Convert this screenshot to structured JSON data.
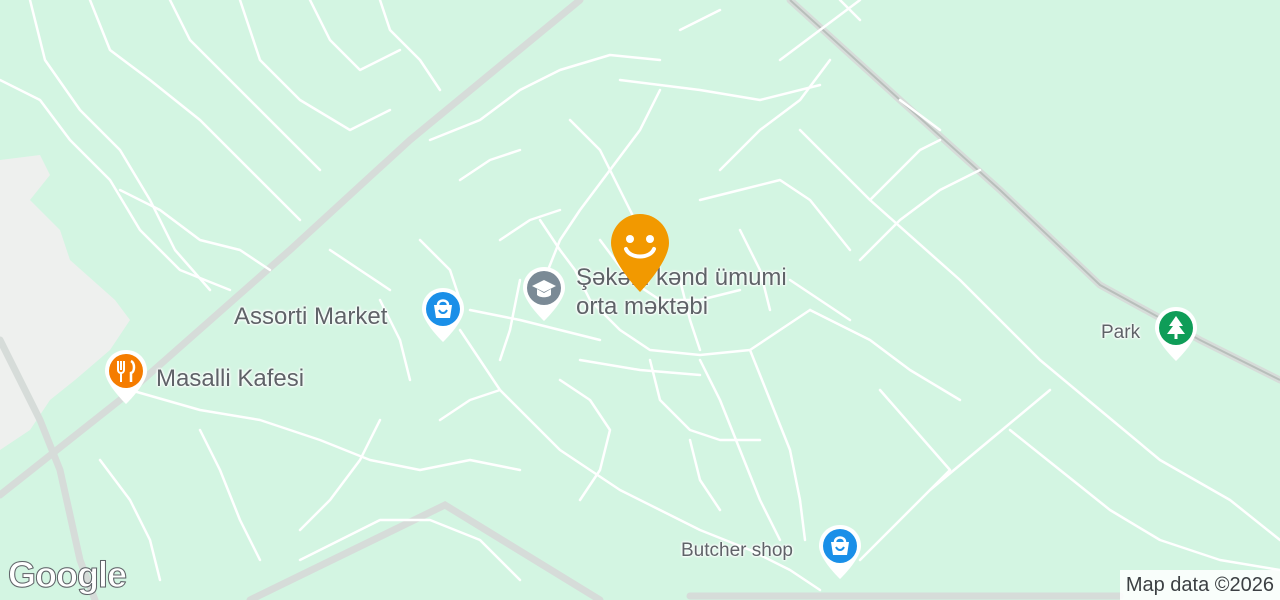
{
  "map": {
    "background_color": "#d3f5e2",
    "road_color": "#ffffff",
    "highway_color": "#d6dcd9",
    "urban_color": "#eef0ee"
  },
  "user_marker": {
    "icon": "smiley-pin-icon",
    "color": "#f29900"
  },
  "pois": [
    {
      "id": "school",
      "name_line1": "Şəkərli kənd ümumi",
      "name_line2": "orta məktəbi",
      "icon": "school-cap-icon",
      "color": "#7b8a96"
    },
    {
      "id": "assorti",
      "name": "Assorti Market",
      "icon": "shopping-bag-icon",
      "color": "#1a8fe8"
    },
    {
      "id": "masalli",
      "name": "Masalli Kafesi",
      "icon": "fork-knife-icon",
      "color": "#f57c00"
    },
    {
      "id": "park",
      "name": "Park",
      "icon": "tree-icon",
      "color": "#0f9d58"
    },
    {
      "id": "butcher",
      "name": "Butcher shop",
      "icon": "shopping-bag-icon",
      "color": "#1a8fe8"
    }
  ],
  "branding": {
    "logo": "Google"
  },
  "attribution": "Map data ©2026"
}
